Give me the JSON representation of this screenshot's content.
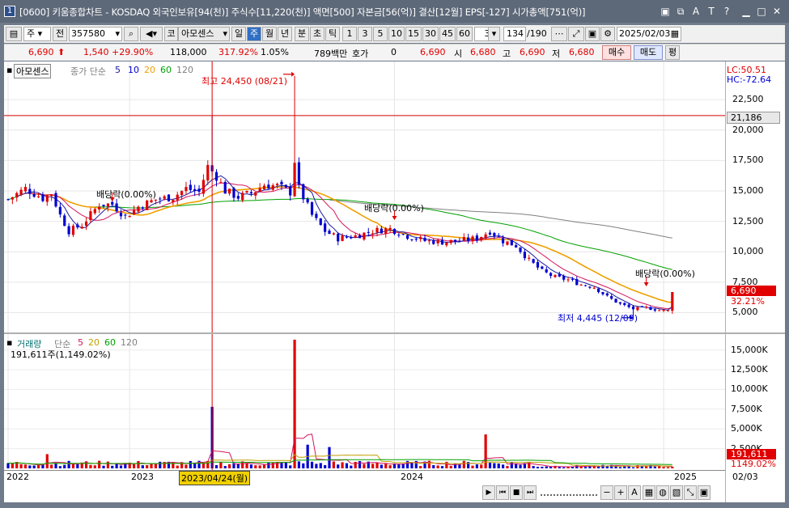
{
  "window": {
    "title": "[0600] 키움종합차트 - KOSDAQ 외국인보유[94(천)] 주식수[11,220(천)] 액면[500] 자본금[56(억)] 결산[12월] EPS[-127] 시가총액[751(억)]",
    "app_icon": "1"
  },
  "toolbar": {
    "period_type": "주",
    "all_label": "전",
    "code": "357580",
    "market_tag": "코",
    "stock_name": "아모센스",
    "periods": [
      "일",
      "주",
      "월",
      "년",
      "분",
      "초",
      "틱"
    ],
    "selected_period": "주",
    "intervals": [
      "1",
      "3",
      "5",
      "10",
      "15",
      "30",
      "45",
      "60"
    ],
    "count_value": "3",
    "page_value": "134",
    "page_total": "/190",
    "date": "2025/02/03"
  },
  "quote": {
    "price": "6,690",
    "change": "1,540",
    "change_pct": "+29.90%",
    "volume": "118,000",
    "volume_pct": "317.92%",
    "turnover": "1.05%",
    "amount": "789백만",
    "hoga_label": "호가",
    "hoga_value": "0",
    "hoga_price": "6,690",
    "open_label": "시",
    "open": "6,680",
    "high_label": "고",
    "high": "6,690",
    "low_label": "저",
    "low": "6,680",
    "buy_label": "매수",
    "sell_label": "매도",
    "eval_label": "평"
  },
  "colors": {
    "up": "#e00000",
    "down": "#0000d0",
    "ma5": "#1a1aa0",
    "ma10": "#d4145a",
    "ma20": "#f0a000",
    "ma60": "#00a000",
    "ma120": "#808080"
  },
  "price_panel": {
    "name": "아모센스",
    "legend_prefix": "종가 단순",
    "legend": [
      "5",
      "10",
      "20",
      "60",
      "120"
    ],
    "lc": "LC:50.51",
    "hc": "HC:-72.64",
    "hline_label": "21,186",
    "price_label": "6,690",
    "pct_label": "32.21%",
    "high_annot": "최고 24,450 (08/21)",
    "low_annot": "최저 4,445 (12/09)",
    "div_annots": [
      "배당락(0.00%)",
      "배당락(0.00%)",
      "배당락(0.00%)"
    ]
  },
  "volume_panel": {
    "title": "거래량",
    "legend_prefix": "단순",
    "legend": [
      "5",
      "20",
      "60",
      "120"
    ],
    "info": "191,611주(1,149.02%)",
    "vol_label": "191,611",
    "vol_pct_label": "1149.02%"
  },
  "x_axis": {
    "labels": [
      "2022",
      "2023",
      "2024",
      "2025"
    ],
    "crosshair_label": "2023/04/24(월)",
    "right_label": "02/03"
  },
  "chart_data": {
    "type": "candlestick",
    "price_axis": {
      "ticks": [
        "22,500",
        "20,000",
        "17,500",
        "15,000",
        "12,500",
        "10,000",
        "7,500",
        "5,000"
      ],
      "values": [
        22500,
        20000,
        17500,
        15000,
        12500,
        10000,
        7500,
        5000
      ],
      "ylim": [
        3500,
        25500
      ]
    },
    "volume_axis": {
      "ticks": [
        "15,000K",
        "12,500K",
        "10,000K",
        "7,500K",
        "5,000K",
        "2,500K"
      ],
      "values": [
        15000,
        12500,
        10000,
        7500,
        5000,
        2500
      ],
      "unit": "K",
      "ylim": [
        0,
        16700
      ]
    },
    "weeks": 160,
    "close_anchors": [
      [
        0,
        14300
      ],
      [
        4,
        15200
      ],
      [
        8,
        14400
      ],
      [
        10,
        14800
      ],
      [
        12,
        13000
      ],
      [
        14,
        11700
      ],
      [
        17,
        12200
      ],
      [
        21,
        13900
      ],
      [
        24,
        13900
      ],
      [
        27,
        12900
      ],
      [
        30,
        13700
      ],
      [
        34,
        14300
      ],
      [
        38,
        14500
      ],
      [
        41,
        15200
      ],
      [
        44,
        14900
      ],
      [
        46,
        17000
      ],
      [
        48,
        16200
      ],
      [
        50,
        15000
      ],
      [
        53,
        14500
      ],
      [
        56,
        14800
      ],
      [
        59,
        15500
      ],
      [
        62,
        15400
      ],
      [
        65,
        14900
      ],
      [
        66,
        17500
      ],
      [
        67,
        15200
      ],
      [
        70,
        13000
      ],
      [
        73,
        11700
      ],
      [
        76,
        11100
      ],
      [
        80,
        11300
      ],
      [
        84,
        11700
      ],
      [
        88,
        11900
      ],
      [
        92,
        11300
      ],
      [
        96,
        10900
      ],
      [
        100,
        10800
      ],
      [
        104,
        10900
      ],
      [
        108,
        11100
      ],
      [
        111,
        11700
      ],
      [
        114,
        10900
      ],
      [
        117,
        10500
      ],
      [
        120,
        9300
      ],
      [
        123,
        8400
      ],
      [
        126,
        7900
      ],
      [
        129,
        7700
      ],
      [
        132,
        7300
      ],
      [
        135,
        7100
      ],
      [
        138,
        6300
      ],
      [
        141,
        5700
      ],
      [
        144,
        5300
      ],
      [
        147,
        5400
      ],
      [
        150,
        5200
      ],
      [
        152,
        5150
      ],
      [
        153,
        6690
      ]
    ],
    "high_point": {
      "week": 66,
      "value": 24450,
      "date": "08/21"
    },
    "low_point": {
      "week": 144,
      "value": 4445,
      "date": "12/09"
    },
    "hline": 21186,
    "crosshair_week": 47,
    "year_starts": [
      0,
      28,
      89,
      151
    ],
    "volume_spikes": [
      [
        9,
        1800
      ],
      [
        47,
        7800
      ],
      [
        66,
        16300
      ],
      [
        69,
        3000
      ],
      [
        74,
        2700
      ],
      [
        110,
        4300
      ]
    ],
    "volume_base": 700,
    "ma5_start": 2,
    "ma10_start": 4,
    "ma20_start": 5,
    "ma60_start": 0,
    "ma120_start": 74
  }
}
